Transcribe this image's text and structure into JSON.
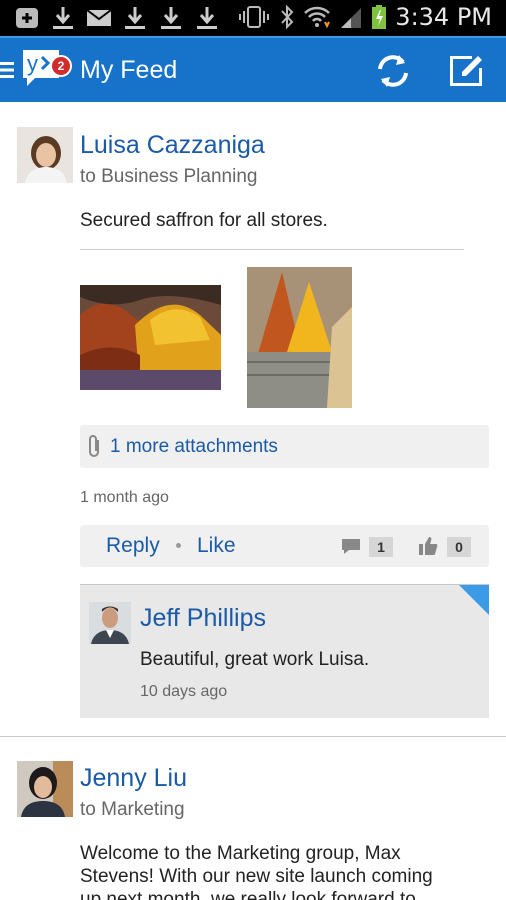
{
  "status_bar": {
    "time": "3:34 PM",
    "left_icons": [
      "add-box-icon",
      "download-icon",
      "mail-icon",
      "download-icon",
      "download-icon",
      "download-icon"
    ],
    "right_icons": [
      "vibrate-icon",
      "bluetooth-icon",
      "wifi-icon",
      "signal-icon",
      "battery-charging-icon"
    ]
  },
  "app_bar": {
    "title": "My Feed",
    "badge_count": "2",
    "logo_icon": "yammer-logo-icon",
    "actions": [
      "refresh-icon",
      "compose-icon"
    ],
    "color": "#1673c9"
  },
  "feed": [
    {
      "author": "Luisa Cazzaniga",
      "group": "to Business Planning",
      "message": "Secured saffron for all stores.",
      "attachments_label": "1 more attachments",
      "timestamp": "1 month ago",
      "actions": {
        "reply": "Reply",
        "like": "Like"
      },
      "comment_count": "1",
      "like_count": "0",
      "reply": {
        "author": "Jeff Phillips",
        "message": "Beautiful, great work Luisa.",
        "timestamp": "10 days ago"
      }
    },
    {
      "author": "Jenny Liu",
      "group": "to Marketing",
      "message_lines": [
        "Welcome to the Marketing group, Max",
        "Stevens! With our new site launch coming",
        "up next month, we really look forward to"
      ]
    }
  ],
  "colors": {
    "link": "#1a5aa6",
    "accent": "#3c9be6"
  }
}
